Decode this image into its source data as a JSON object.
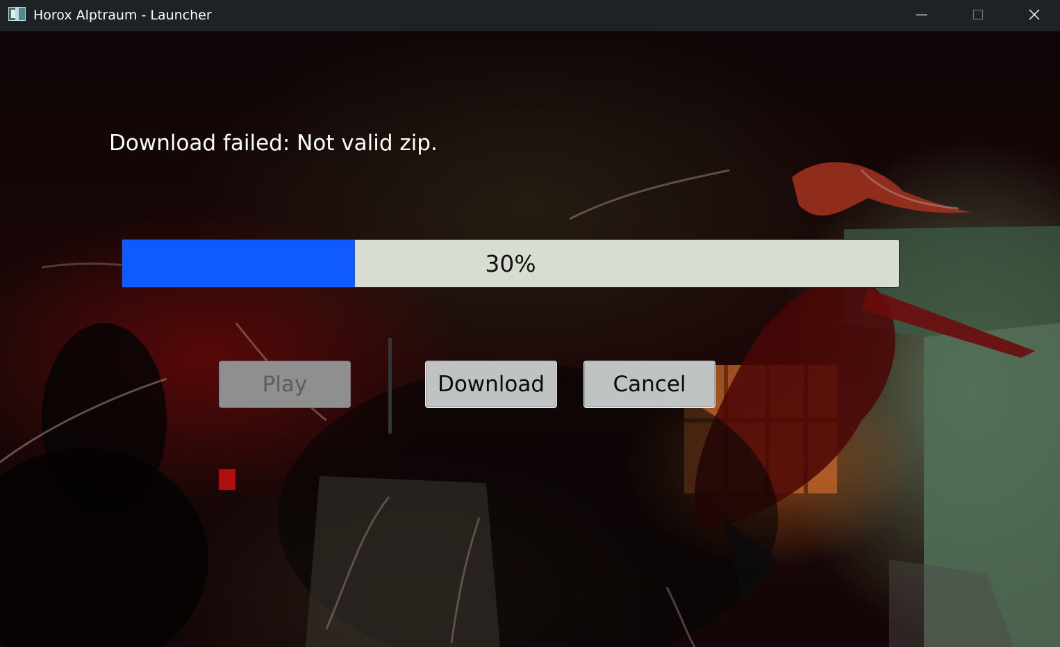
{
  "window": {
    "title": "Horox Alptraum - Launcher",
    "controls": [
      "minimize-icon",
      "maximize-icon",
      "close-icon"
    ]
  },
  "status": {
    "message": "Download failed: Not valid zip."
  },
  "progress": {
    "value_percent": 30,
    "label": "30%",
    "fill_color": "#0f5bff",
    "track_color": "#d8ddd2"
  },
  "buttons": {
    "play": {
      "label": "Play",
      "enabled": false
    },
    "download": {
      "label": "Download",
      "enabled": true
    },
    "cancel": {
      "label": "Cancel",
      "enabled": true
    }
  },
  "colors": {
    "titlebar_bg": "#1f2224",
    "button_bg": "#c0c3c4",
    "button_disabled_bg": "#8f8f8f"
  }
}
